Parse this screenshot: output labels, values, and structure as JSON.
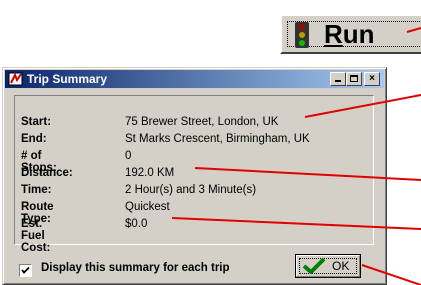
{
  "run_button": {
    "label": "Run",
    "icon": "traffic-light-icon"
  },
  "window": {
    "title": "Trip Summary",
    "title_icon": "trip-summary-icon",
    "controls": {
      "minimize": "minimize-icon",
      "maximize": "maximize-icon",
      "close_label": "×"
    }
  },
  "summary": {
    "rows": [
      {
        "label": "Start:",
        "value": "75 Brewer Street, London, UK"
      },
      {
        "label": "End:",
        "value": "St Marks Crescent, Birmingham, UK"
      },
      {
        "label": "# of Stops:",
        "value": "0"
      },
      {
        "label": "Distance:",
        "value": "192.0 KM"
      },
      {
        "label": "Time:",
        "value": "2 Hour(s) and 3 Minute(s)"
      },
      {
        "label": "Route Type:",
        "value": "Quickest"
      },
      {
        "label": "Est. Fuel Cost:",
        "value": "$0.0"
      }
    ]
  },
  "checkbox": {
    "label": "Display this summary for each trip",
    "checked": true
  },
  "ok_button": {
    "label": "OK",
    "icon": "green-check-icon"
  },
  "colors": {
    "titlebar_start": "#0a246a",
    "titlebar_end": "#a6caf0",
    "callout": "#ff0000",
    "face": "#d4d0c8"
  }
}
